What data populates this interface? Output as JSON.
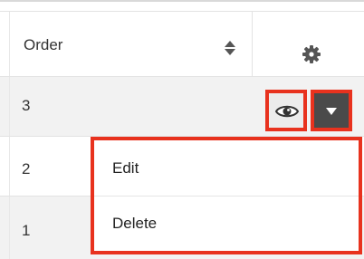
{
  "table": {
    "header": {
      "order_label": "Order",
      "sort_icon": "sort-updown-icon",
      "settings_icon": "gear-icon"
    },
    "rows": [
      {
        "order": "3"
      },
      {
        "order": "2"
      },
      {
        "order": "1"
      }
    ]
  },
  "row_actions": {
    "preview_icon": "eye-icon",
    "dropdown_icon": "caret-down-icon"
  },
  "dropdown_menu": {
    "items": [
      {
        "label": "Edit"
      },
      {
        "label": "Delete"
      }
    ]
  },
  "colors": {
    "highlight": "#e8321e",
    "row_alt": "#f2f2f2",
    "dark_button": "#4a4a4a"
  }
}
